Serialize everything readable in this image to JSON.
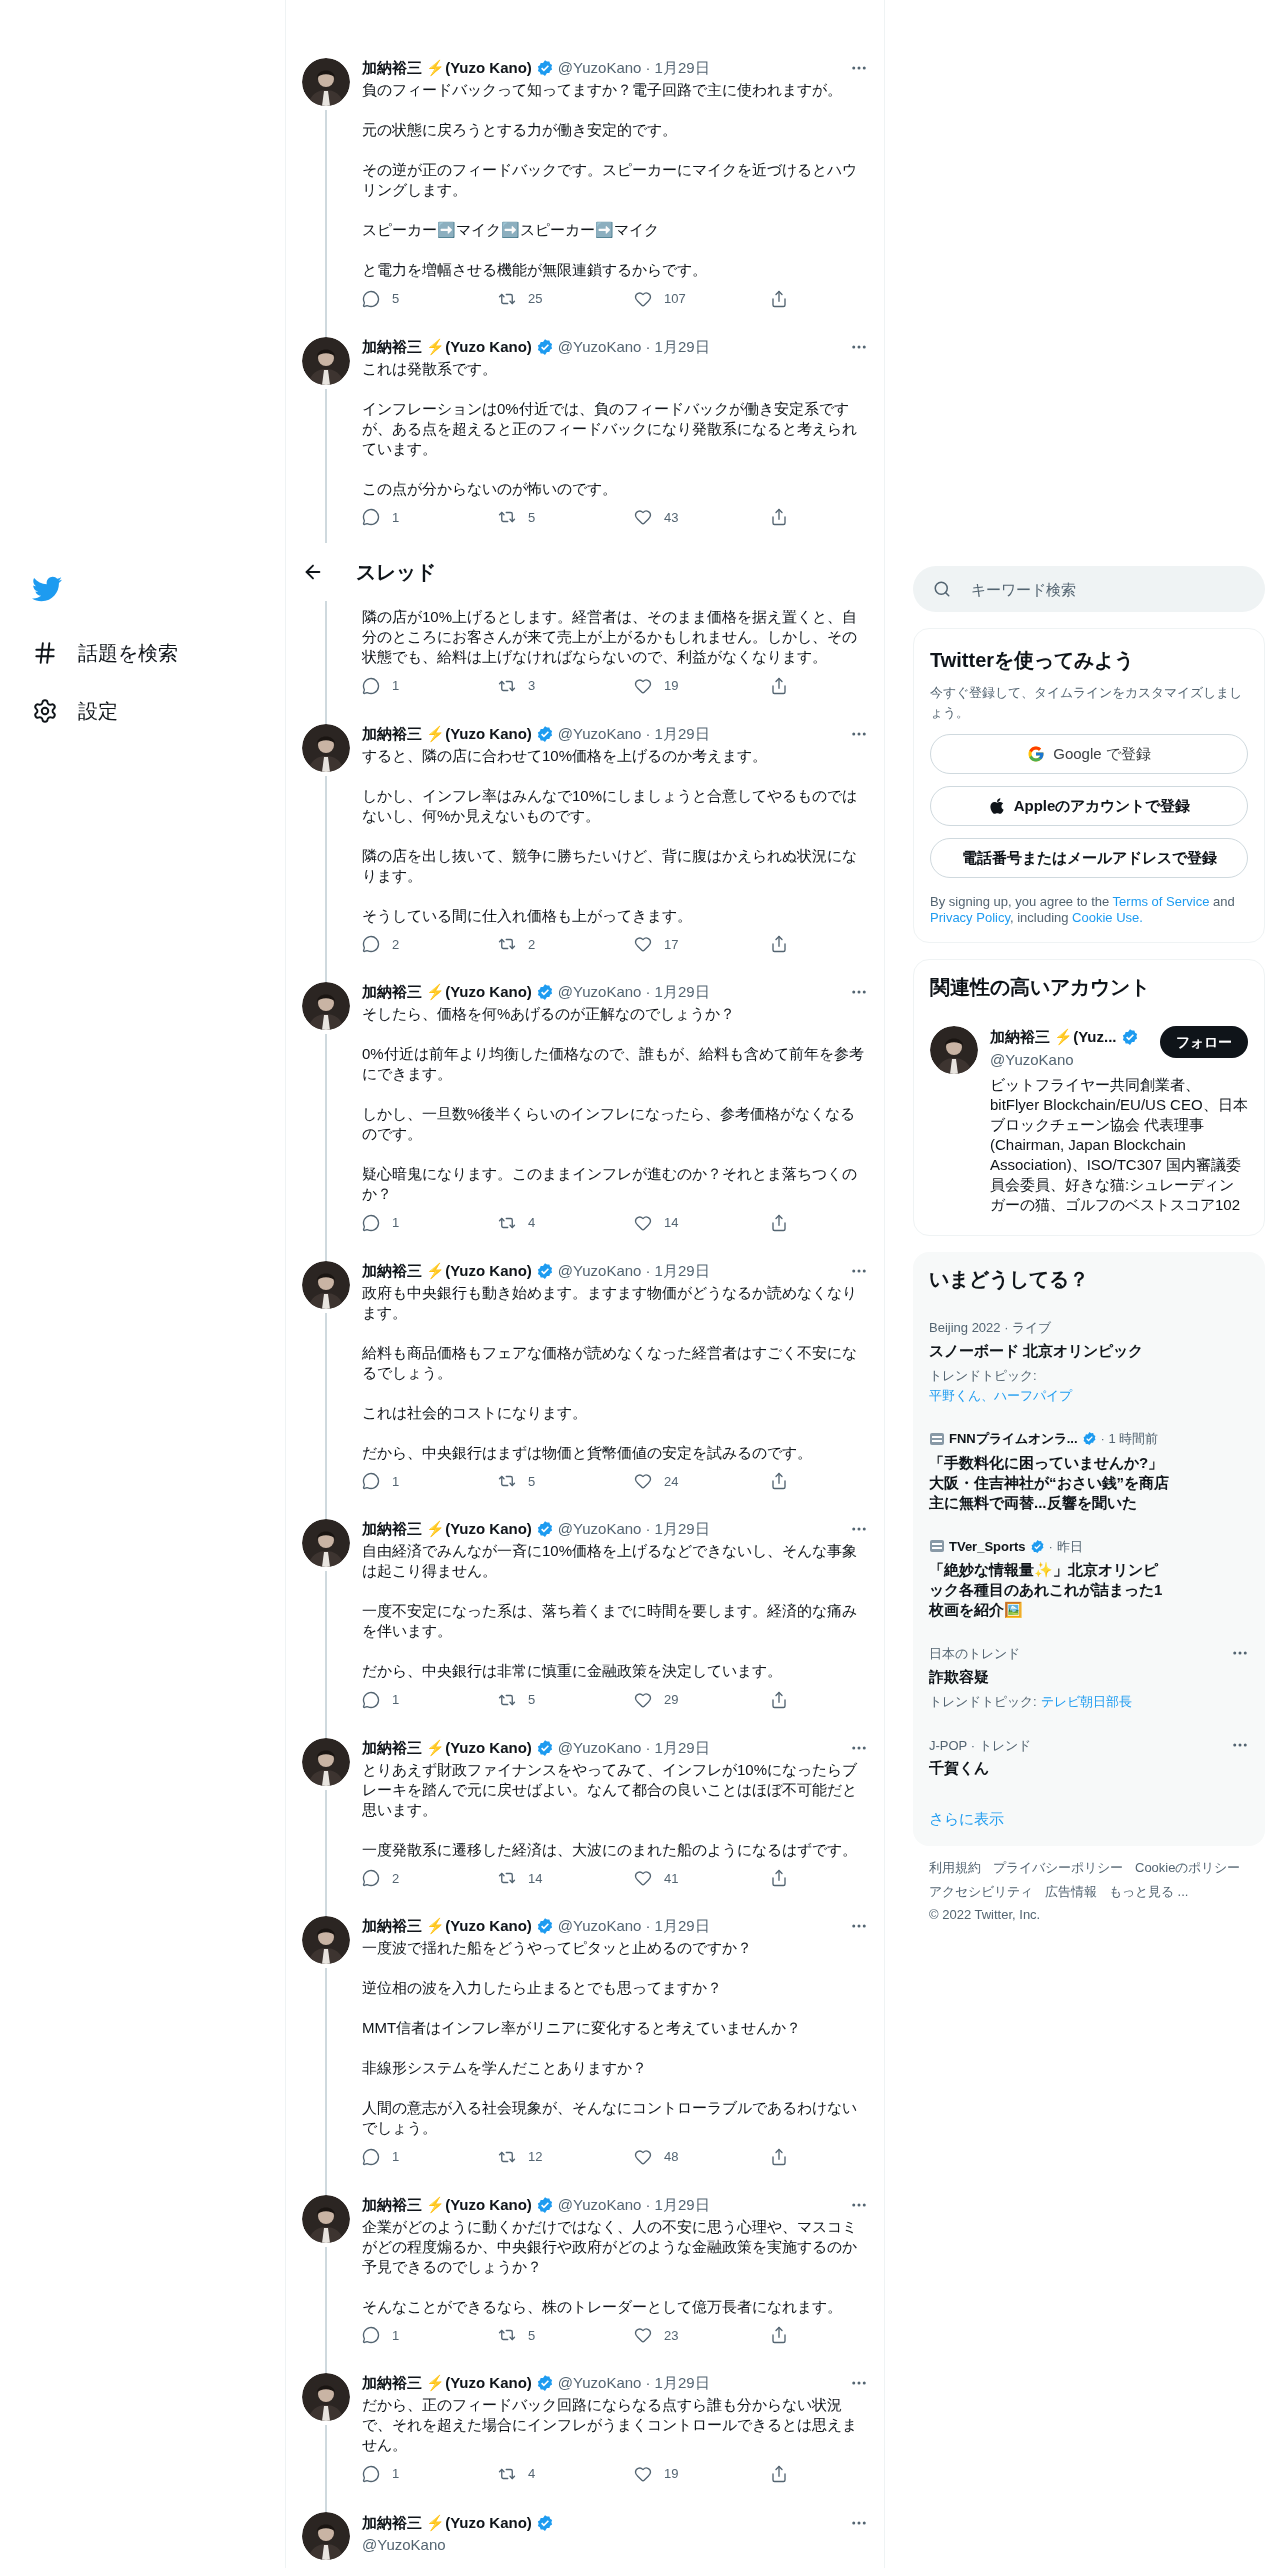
{
  "nav": {
    "items": [
      {
        "label": "話題を検索"
      },
      {
        "label": "設定"
      }
    ]
  },
  "header": {
    "title": "スレッド"
  },
  "tweets": [
    {
      "kind": "reply",
      "name": "加納裕三 ⚡(Yuzo Kano)",
      "handle": "@YuzoKano",
      "date": "· 1月29日",
      "paragraphs": [
        "負のフィードバックって知ってますか？電子回路で主に使われますが。",
        "元の状態に戻ろうとする力が働き安定的です。",
        "その逆が正のフィードバックです。スピーカーにマイクを近づけるとハウリングします。",
        "スピーカー➡️マイク➡️スピーカー➡️マイク",
        "と電力を増幅させる機能が無限連鎖するからです。"
      ],
      "replies": "5",
      "retweets": "25",
      "likes": "107"
    },
    {
      "kind": "reply",
      "name": "加納裕三 ⚡(Yuzo Kano)",
      "handle": "@YuzoKano",
      "date": "· 1月29日",
      "paragraphs": [
        "これは発散系です。",
        "インフレーションは0%付近では、負のフィードバックが働き安定系ですが、ある点を超えると正のフィードバックになり発散系になると考えられています。",
        "この点が分からないのが怖いのです。"
      ],
      "replies": "1",
      "retweets": "5",
      "likes": "43"
    },
    {
      "kind": "partial",
      "paragraphs": [
        "隣の店が10%上げるとします。経営者は、そのまま価格を据え置くと、自分のところにお客さんが来て売上が上がるかもしれません。しかし、その状態でも、給料は上げなければならないので、利益がなくなります。"
      ],
      "replies": "1",
      "retweets": "3",
      "likes": "19"
    },
    {
      "kind": "reply",
      "name": "加納裕三 ⚡(Yuzo Kano)",
      "handle": "@YuzoKano",
      "date": "· 1月29日",
      "paragraphs": [
        "すると、隣の店に合わせて10%価格を上げるのか考えます。",
        "しかし、インフレ率はみんなで10%にしましょうと合意してやるものではないし、何%か見えないものです。",
        "隣の店を出し抜いて、競争に勝ちたいけど、背に腹はかえられぬ状況になります。",
        "そうしている間に仕入れ価格も上がってきます。"
      ],
      "replies": "2",
      "retweets": "2",
      "likes": "17"
    },
    {
      "kind": "reply",
      "name": "加納裕三 ⚡(Yuzo Kano)",
      "handle": "@YuzoKano",
      "date": "· 1月29日",
      "paragraphs": [
        "そしたら、価格を何%あげるのが正解なのでしょうか？",
        "0%付近は前年より均衡した価格なので、誰もが、給料も含めて前年を参考にできます。",
        "しかし、一旦数%後半くらいのインフレになったら、参考価格がなくなるのです。",
        "疑心暗鬼になります。このままインフレが進むのか？それとま落ちつくのか？"
      ],
      "replies": "1",
      "retweets": "4",
      "likes": "14"
    },
    {
      "kind": "reply",
      "name": "加納裕三 ⚡(Yuzo Kano)",
      "handle": "@YuzoKano",
      "date": "· 1月29日",
      "paragraphs": [
        "政府も中央銀行も動き始めます。ますます物価がどうなるか読めなくなります。",
        "給料も商品価格もフェアな価格が読めなくなった経営者はすごく不安になるでしょう。",
        "これは社会的コストになります。",
        "だから、中央銀行はまずは物価と貨幣価値の安定を試みるのです。"
      ],
      "replies": "1",
      "retweets": "5",
      "likes": "24"
    },
    {
      "kind": "reply",
      "name": "加納裕三 ⚡(Yuzo Kano)",
      "handle": "@YuzoKano",
      "date": "· 1月29日",
      "paragraphs": [
        "自由経済でみんなが一斉に10%価格を上げるなどできないし、そんな事象は起こり得ません。",
        "一度不安定になった系は、落ち着くまでに時間を要します。経済的な痛みを伴います。",
        "だから、中央銀行は非常に慎重に金融政策を決定しています。"
      ],
      "replies": "1",
      "retweets": "5",
      "likes": "29"
    },
    {
      "kind": "reply",
      "name": "加納裕三 ⚡(Yuzo Kano)",
      "handle": "@YuzoKano",
      "date": "· 1月29日",
      "paragraphs": [
        "とりあえず財政ファイナンスをやってみて、インフレが10%になったらブレーキを踏んで元に戻せばよい。なんて都合の良いことはほぼ不可能だと思います。",
        "一度発散系に遷移した経済は、大波にのまれた船のようになるはずです。"
      ],
      "replies": "2",
      "retweets": "14",
      "likes": "41"
    },
    {
      "kind": "reply",
      "name": "加納裕三 ⚡(Yuzo Kano)",
      "handle": "@YuzoKano",
      "date": "· 1月29日",
      "paragraphs": [
        "一度波で揺れた船をどうやってピタッと止めるのですか？",
        "逆位相の波を入力したら止まるとでも思ってますか？",
        "MMT信者はインフレ率がリニアに変化すると考えていませんか？",
        "非線形システムを学んだことありますか？",
        "人間の意志が入る社会現象が、そんなにコントローラブルであるわけないでしょう。"
      ],
      "replies": "1",
      "retweets": "12",
      "likes": "48"
    },
    {
      "kind": "reply",
      "name": "加納裕三 ⚡(Yuzo Kano)",
      "handle": "@YuzoKano",
      "date": "· 1月29日",
      "paragraphs": [
        "企業がどのように動くかだけではなく、人の不安に思う心理や、マスコミがどの程度煽るか、中央銀行や政府がどのような金融政策を実施するのか予見できるのでしょうか？",
        "そんなことができるなら、株のトレーダーとして億万長者になれます。"
      ],
      "replies": "1",
      "retweets": "5",
      "likes": "23"
    },
    {
      "kind": "reply",
      "name": "加納裕三 ⚡(Yuzo Kano)",
      "handle": "@YuzoKano",
      "date": "· 1月29日",
      "paragraphs": [
        "だから、正のフィードバック回路にならなる点すら誰も分からない状況で、それを超えた場合にインフレがうまくコントロールできるとは思えません。"
      ],
      "replies": "1",
      "retweets": "4",
      "likes": "19"
    },
    {
      "kind": "main",
      "name": "加納裕三 ⚡(Yuzo Kano)",
      "handle": "@YuzoKano"
    }
  ],
  "search": {
    "placeholder": "キーワード検索"
  },
  "signup": {
    "title": "Twitterを使ってみよう",
    "subtitle": "今すぐ登録して、タイムラインをカスタマイズしましょう。",
    "buttons": [
      {
        "kind": "google",
        "label": "Google で登録"
      },
      {
        "kind": "apple",
        "label": "Appleのアカウントで登録"
      },
      {
        "kind": "plain",
        "label": "電話番号またはメールアドレスで登録"
      }
    ],
    "legal": [
      {
        "kind": "text",
        "text": "By signing up, you agree to the "
      },
      {
        "kind": "link",
        "text": "Terms of Service"
      },
      {
        "kind": "text",
        "text": " and "
      },
      {
        "kind": "link",
        "text": "Privacy Policy"
      },
      {
        "kind": "text",
        "text": ", including "
      },
      {
        "kind": "link",
        "text": "Cookie Use."
      }
    ]
  },
  "related": {
    "title": "関連性の高いアカウント",
    "account": {
      "name": "加納裕三 ⚡(Yuz...",
      "handle": "@YuzoKano",
      "follow": "フォロー",
      "bio": "ビットフライヤー共同創業者、bitFlyer Blockchain/EU/US CEO、日本ブロックチェーン協会 代表理事(Chairman, Japan Blockchain Association)、ISO/TC307 国内審議委員会委員、好きな猫:シュレーディンガーの猫、ゴルフのベストスコア102"
    }
  },
  "trends": {
    "title": "いまどうしてる？",
    "items": [
      {
        "kind": "topic",
        "meta": "Beijing 2022 · ライブ",
        "title": "スノーボード 北京オリンピック",
        "topics_label": "トレンドトピック:",
        "topics": "平野くん、ハーフパイプ"
      },
      {
        "kind": "news",
        "source": "FNNプライムオンラ...",
        "time": "· 1 時間前",
        "title": "「手数料化に困っていませんか?」大阪・住吉神社が“おさい銭”を商店主に無料で両替...反響を聞いた"
      },
      {
        "kind": "news",
        "source": "TVer_Sports",
        "time": "· 昨日",
        "title": "「絶妙な情報量✨」北京オリンピック各種目のあれこれが詰まった1枚画を紹介🖼️"
      },
      {
        "kind": "trend",
        "meta": "日本のトレンド",
        "title": "詐欺容疑",
        "topics_label": "トレンドトピック:",
        "topics": "テレビ朝日部長"
      },
      {
        "kind": "trend",
        "meta": "J-POP · トレンド",
        "title": "千賀くん"
      }
    ],
    "show_more": "さらに表示"
  },
  "footer": {
    "links": [
      "利用規約",
      "プライバシーポリシー",
      "Cookieのポリシー",
      "アクセシビリティ",
      "広告情報",
      "もっと見る ...",
      "© 2022 Twitter, Inc."
    ]
  }
}
